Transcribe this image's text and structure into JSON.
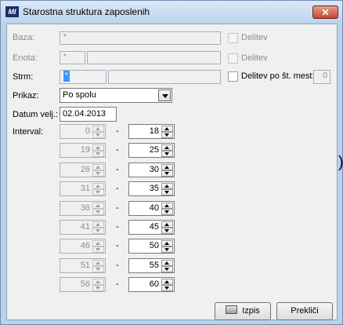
{
  "window": {
    "title": "Starostna struktura zaposlenih",
    "close_label": "✕",
    "app_icon_text": "MI"
  },
  "fields": {
    "baza": {
      "label": "Baza:",
      "value": "*"
    },
    "enota": {
      "label": "Enota:",
      "value": "*"
    },
    "strm": {
      "label": "Strm:",
      "value": "*"
    }
  },
  "checkboxes": {
    "delitev1": {
      "label": "Delitev",
      "checked": false
    },
    "delitev2": {
      "label": "Delitev",
      "checked": false
    },
    "delitev_mest": {
      "label": "Delitev po št. mest:",
      "checked": false,
      "count": "0"
    }
  },
  "prikaz": {
    "label": "Prikaz:",
    "value": "Po spolu"
  },
  "datum": {
    "label": "Datum velj.:",
    "value": "02.04.2013"
  },
  "interval": {
    "label": "Interval:",
    "separator": "-",
    "rows": [
      {
        "from": "0",
        "to": "18"
      },
      {
        "from": "19",
        "to": "25"
      },
      {
        "from": "26",
        "to": "30"
      },
      {
        "from": "31",
        "to": "35"
      },
      {
        "from": "36",
        "to": "40"
      },
      {
        "from": "41",
        "to": "45"
      },
      {
        "from": "46",
        "to": "50"
      },
      {
        "from": "51",
        "to": "55"
      },
      {
        "from": "56",
        "to": "60"
      }
    ]
  },
  "buttons": {
    "izpis": "Izpis",
    "preklici": "Prekliči"
  },
  "colors": {
    "selection": "#3399ff",
    "titlebar": "#bcd3ec",
    "close": "#c8442c"
  }
}
